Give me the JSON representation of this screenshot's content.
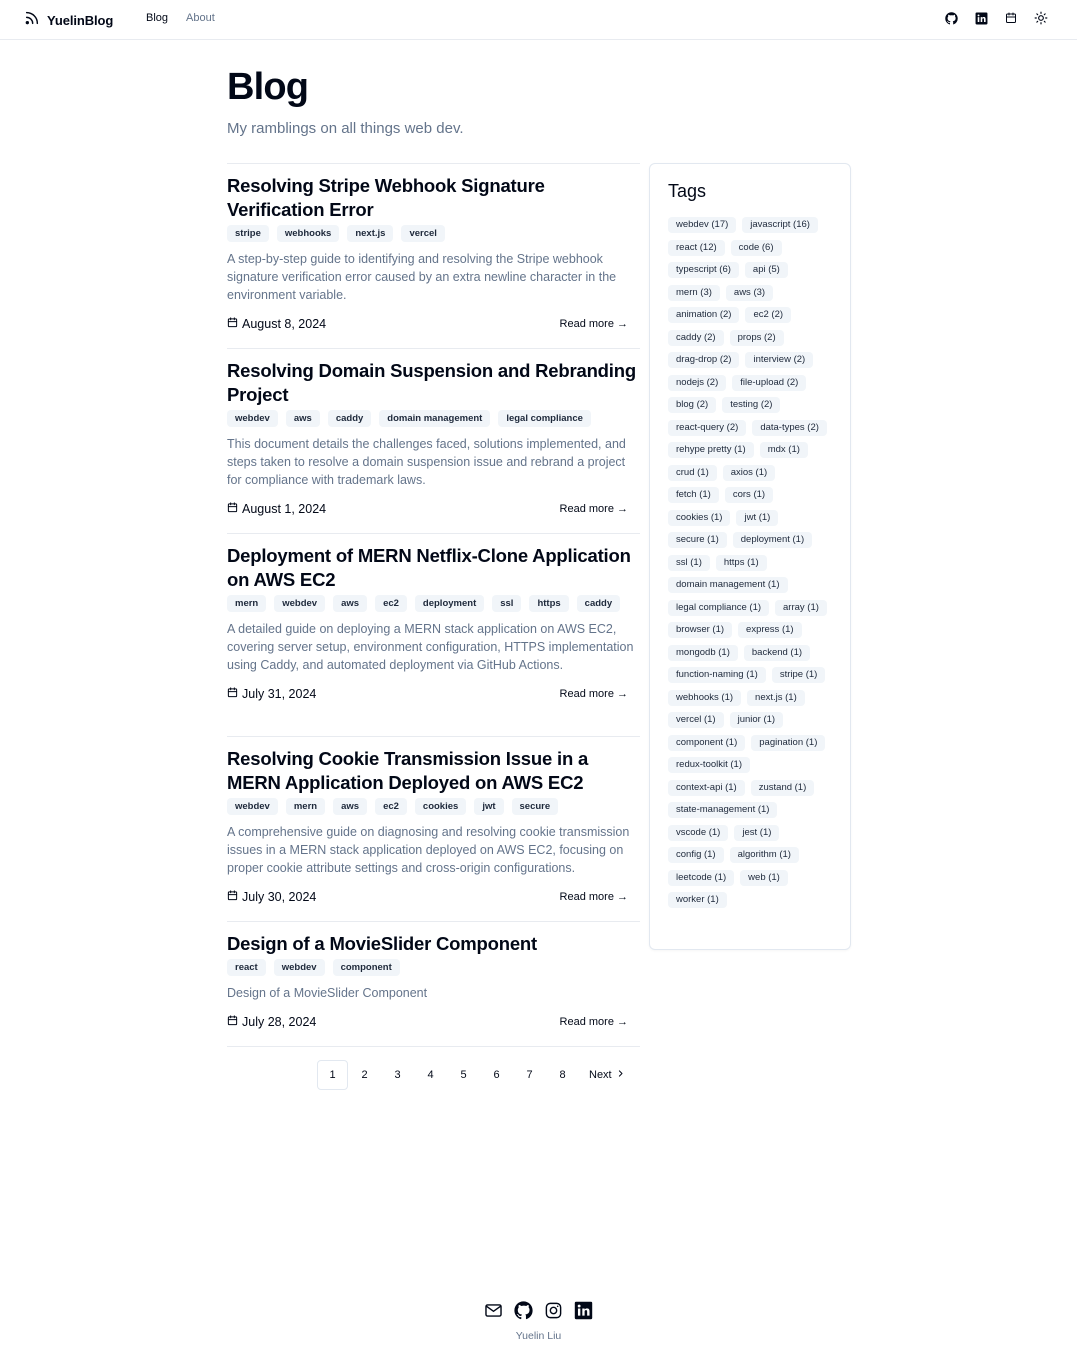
{
  "header": {
    "brand": "YuelinBlog",
    "nav": [
      {
        "label": "Blog",
        "active": true
      },
      {
        "label": "About",
        "active": false
      }
    ],
    "icons": [
      "github-icon",
      "linkedin-icon",
      "calendar-icon",
      "sun-icon"
    ]
  },
  "page": {
    "title": "Blog",
    "subtitle": "My ramblings on all things web dev."
  },
  "posts": [
    {
      "title": "Resolving Stripe Webhook Signature Verification Error",
      "tags": [
        "stripe",
        "webhooks",
        "next.js",
        "vercel"
      ],
      "description": "A step-by-step guide to identifying and resolving the Stripe webhook signature verification error caused by an extra newline character in the environment variable.",
      "date": "August 8, 2024",
      "read_more": "Read more →"
    },
    {
      "title": "Resolving Domain Suspension and Rebranding Project",
      "tags": [
        "webdev",
        "aws",
        "caddy",
        "domain management",
        "legal compliance"
      ],
      "description": "This document details the challenges faced, solutions implemented, and steps taken to resolve a domain suspension issue and rebrand a project for compliance with trademark laws.",
      "date": "August 1, 2024",
      "read_more": "Read more →"
    },
    {
      "title": "Deployment of MERN Netflix-Clone Application on AWS EC2",
      "tags": [
        "mern",
        "webdev",
        "aws",
        "ec2",
        "deployment",
        "ssl",
        "https",
        "caddy"
      ],
      "description": "A detailed guide on deploying a MERN stack application on AWS EC2, covering server setup, environment configuration, HTTPS implementation using Caddy, and automated deployment via GitHub Actions.",
      "date": "July 31, 2024",
      "read_more": "Read more →"
    },
    {
      "title": "Resolving Cookie Transmission Issue in a MERN Application Deployed on AWS EC2",
      "tags": [
        "webdev",
        "mern",
        "aws",
        "ec2",
        "cookies",
        "jwt",
        "secure"
      ],
      "description": "A comprehensive guide on diagnosing and resolving cookie transmission issues in a MERN stack application deployed on AWS EC2, focusing on proper cookie attribute settings and cross-origin configurations.",
      "date": "July 30, 2024",
      "read_more": "Read more →"
    },
    {
      "title": "Design of a MovieSlider Component",
      "tags": [
        "react",
        "webdev",
        "component"
      ],
      "description": "Design of a MovieSlider Component",
      "date": "July 28, 2024",
      "read_more": "Read more →"
    }
  ],
  "pagination": {
    "pages": [
      "1",
      "2",
      "3",
      "4",
      "5",
      "6",
      "7",
      "8"
    ],
    "current": "1",
    "next_label": "Next"
  },
  "sidebar": {
    "title": "Tags",
    "tags": [
      "webdev (17)",
      "javascript (16)",
      "react (12)",
      "code (6)",
      "typescript (6)",
      "api (5)",
      "mern (3)",
      "aws (3)",
      "animation (2)",
      "ec2 (2)",
      "caddy (2)",
      "props (2)",
      "drag-drop (2)",
      "interview (2)",
      "nodejs (2)",
      "file-upload (2)",
      "blog (2)",
      "testing (2)",
      "react-query (2)",
      "data-types (2)",
      "rehype pretty (1)",
      "mdx (1)",
      "crud (1)",
      "axios (1)",
      "fetch (1)",
      "cors (1)",
      "cookies (1)",
      "jwt (1)",
      "secure (1)",
      "deployment (1)",
      "ssl (1)",
      "https (1)",
      "domain management (1)",
      "legal compliance (1)",
      "array (1)",
      "browser (1)",
      "express (1)",
      "mongodb (1)",
      "backend (1)",
      "function-naming (1)",
      "stripe (1)",
      "webhooks (1)",
      "next.js (1)",
      "vercel (1)",
      "junior (1)",
      "component (1)",
      "pagination (1)",
      "redux-toolkit (1)",
      "context-api (1)",
      "zustand (1)",
      "state-management (1)",
      "vscode (1)",
      "jest (1)",
      "config (1)",
      "algorithm (1)",
      "leetcode (1)",
      "web (1)",
      "worker (1)"
    ]
  },
  "footer": {
    "icons": [
      "mail-icon",
      "github-icon",
      "instagram-icon",
      "linkedin-icon"
    ],
    "author": "Yuelin Liu"
  }
}
